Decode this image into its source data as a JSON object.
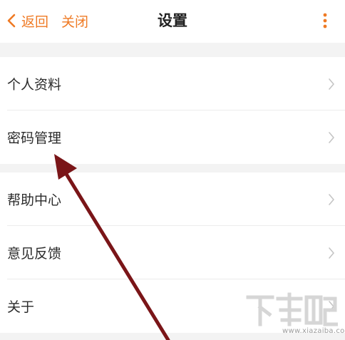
{
  "header": {
    "back_label": "返回",
    "close_label": "关闭",
    "title": "设置",
    "accent_color": "#ef7a24"
  },
  "groups": [
    {
      "items": [
        {
          "label": "个人资料",
          "icon": "chevron-right-icon"
        },
        {
          "label": "密码管理",
          "icon": "chevron-right-icon"
        }
      ]
    },
    {
      "items": [
        {
          "label": "帮助中心",
          "icon": "chevron-right-icon"
        },
        {
          "label": "意见反馈",
          "icon": "chevron-right-icon"
        },
        {
          "label": "关于",
          "icon": "chevron-right-icon"
        }
      ]
    }
  ],
  "annotation": {
    "arrow_color": "#7a1518",
    "points_to": "密码管理"
  },
  "watermark": {
    "url": "www.xiazaiba.com"
  }
}
